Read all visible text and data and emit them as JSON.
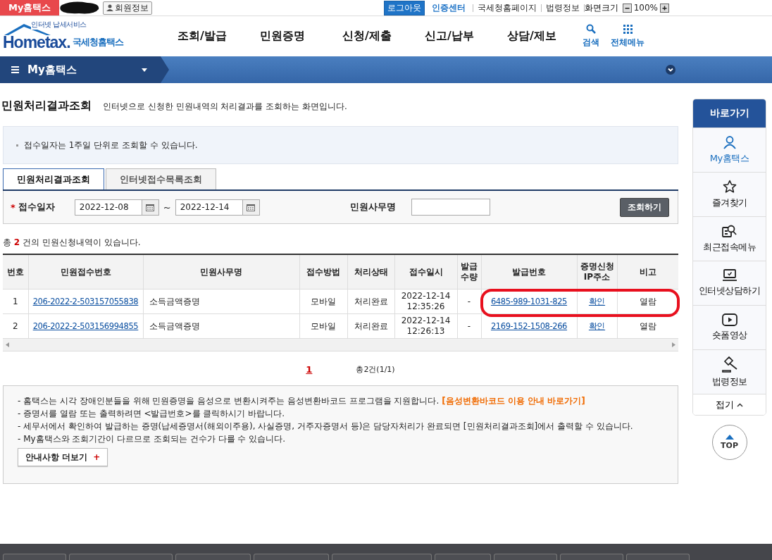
{
  "top_bar": {
    "my_hometax": "My홈택스",
    "member_info": "회원정보",
    "logout": "로그아웃",
    "cert_center": "인증센터",
    "links": [
      "국세청홈페이지",
      "법령정보"
    ],
    "zoom_label": "화면크기",
    "zoom_value": "100%"
  },
  "header": {
    "logo_tagline": "인터넷 납세서비스",
    "logo_text": "Hometax.",
    "brand": "국세청홈택스",
    "nav": [
      "조회/발급",
      "민원증명",
      "신청/제출",
      "신고/납부",
      "상담/제보"
    ],
    "search": "검색",
    "all_menu": "전체메뉴"
  },
  "location_bar": {
    "menu": "My홈택스"
  },
  "page": {
    "title": "민원처리결과조회",
    "description": "인터넷으로 신청한 민원내역의 처리결과를 조회하는 화면입니다."
  },
  "notice": "접수일자는 1주일 단위로 조회할 수 있습니다.",
  "tabs": [
    {
      "label": "민원처리결과조회",
      "selected": true
    },
    {
      "label": "인터넷접수목록조회",
      "selected": false
    }
  ],
  "filter": {
    "required_mark": "*",
    "date_label": "접수일자",
    "date_from": "2022-12-08",
    "separator": "~",
    "date_to": "2022-12-14",
    "service_label": "민원사무명",
    "search_button": "조회하기"
  },
  "summary": "총 **2** 건의 민원신청내역이 있습니다.",
  "table": {
    "columns": [
      "번호",
      "민원접수번호",
      "민원사무명",
      "접수방법",
      "처리상태",
      "접수일시",
      "발급 수량",
      "발급번호",
      "증명신청 IP주소",
      "비고"
    ],
    "rows": [
      {
        "no": "1",
        "receipt_no": "206-2022-2-503157055838",
        "service": "소득금액증명",
        "method": "모바일",
        "status": "처리완료",
        "date": "2022-12-14",
        "time": "12:35:26",
        "quantity": "-",
        "issue_no": "6485-989-1031-825",
        "ip": "확인",
        "remark": "열람",
        "highlighted": true
      },
      {
        "no": "2",
        "receipt_no": "206-2022-2-503156994855",
        "service": "소득금액증명",
        "method": "모바일",
        "status": "처리완료",
        "date": "2022-12-14",
        "time": "12:26:13",
        "quantity": "-",
        "issue_no": "2169-152-1508-266",
        "ip": "확인",
        "remark": "열람",
        "highlighted": false
      }
    ]
  },
  "pagination": {
    "pages": [
      {
        "label": "1",
        "selected": true
      }
    ],
    "total": "총2건(1/1)"
  },
  "guide": {
    "lines": [
      "- 홈택스는 시각 장애인분들을 위해 민원증명을 음성으로 변환시켜주는 음성변환바코드 프로그램을 지원합니다.",
      "- 증명서를 열람 또는 출력하려면 <발급번호>를 클릭하시기 바랍니다.",
      "- 세무서에서 확인하여 발급하는 증명(납세증명서(해외이주용), 사실증명, 거주자증명서 등)은 담당자처리가 완료되면 [민원처리결과조회]에서 출력할 수 있습니다.",
      "- My홈택스와 조회기간이 다르므로 조회되는 건수가 다를 수 있습니다."
    ],
    "link": "[음성변환바코드 이용 안내 바로가기]",
    "more_button": "안내사항 더보기",
    "more_icon": "+"
  },
  "sidebar": {
    "title": "바로가기",
    "items": [
      {
        "label": "My홈택스",
        "kind": "person",
        "selected": true
      },
      {
        "label": "즐겨찾기",
        "kind": "star",
        "selected": false
      },
      {
        "label": "최근접속메뉴",
        "kind": "recent",
        "selected": false
      },
      {
        "label": "인터넷상담하기",
        "kind": "laptop",
        "selected": false
      },
      {
        "label": "숏폼영상",
        "kind": "video",
        "selected": false
      },
      {
        "label": "법령정보",
        "kind": "gavel",
        "selected": false
      }
    ],
    "collapse": "접기",
    "top": "TOP"
  }
}
